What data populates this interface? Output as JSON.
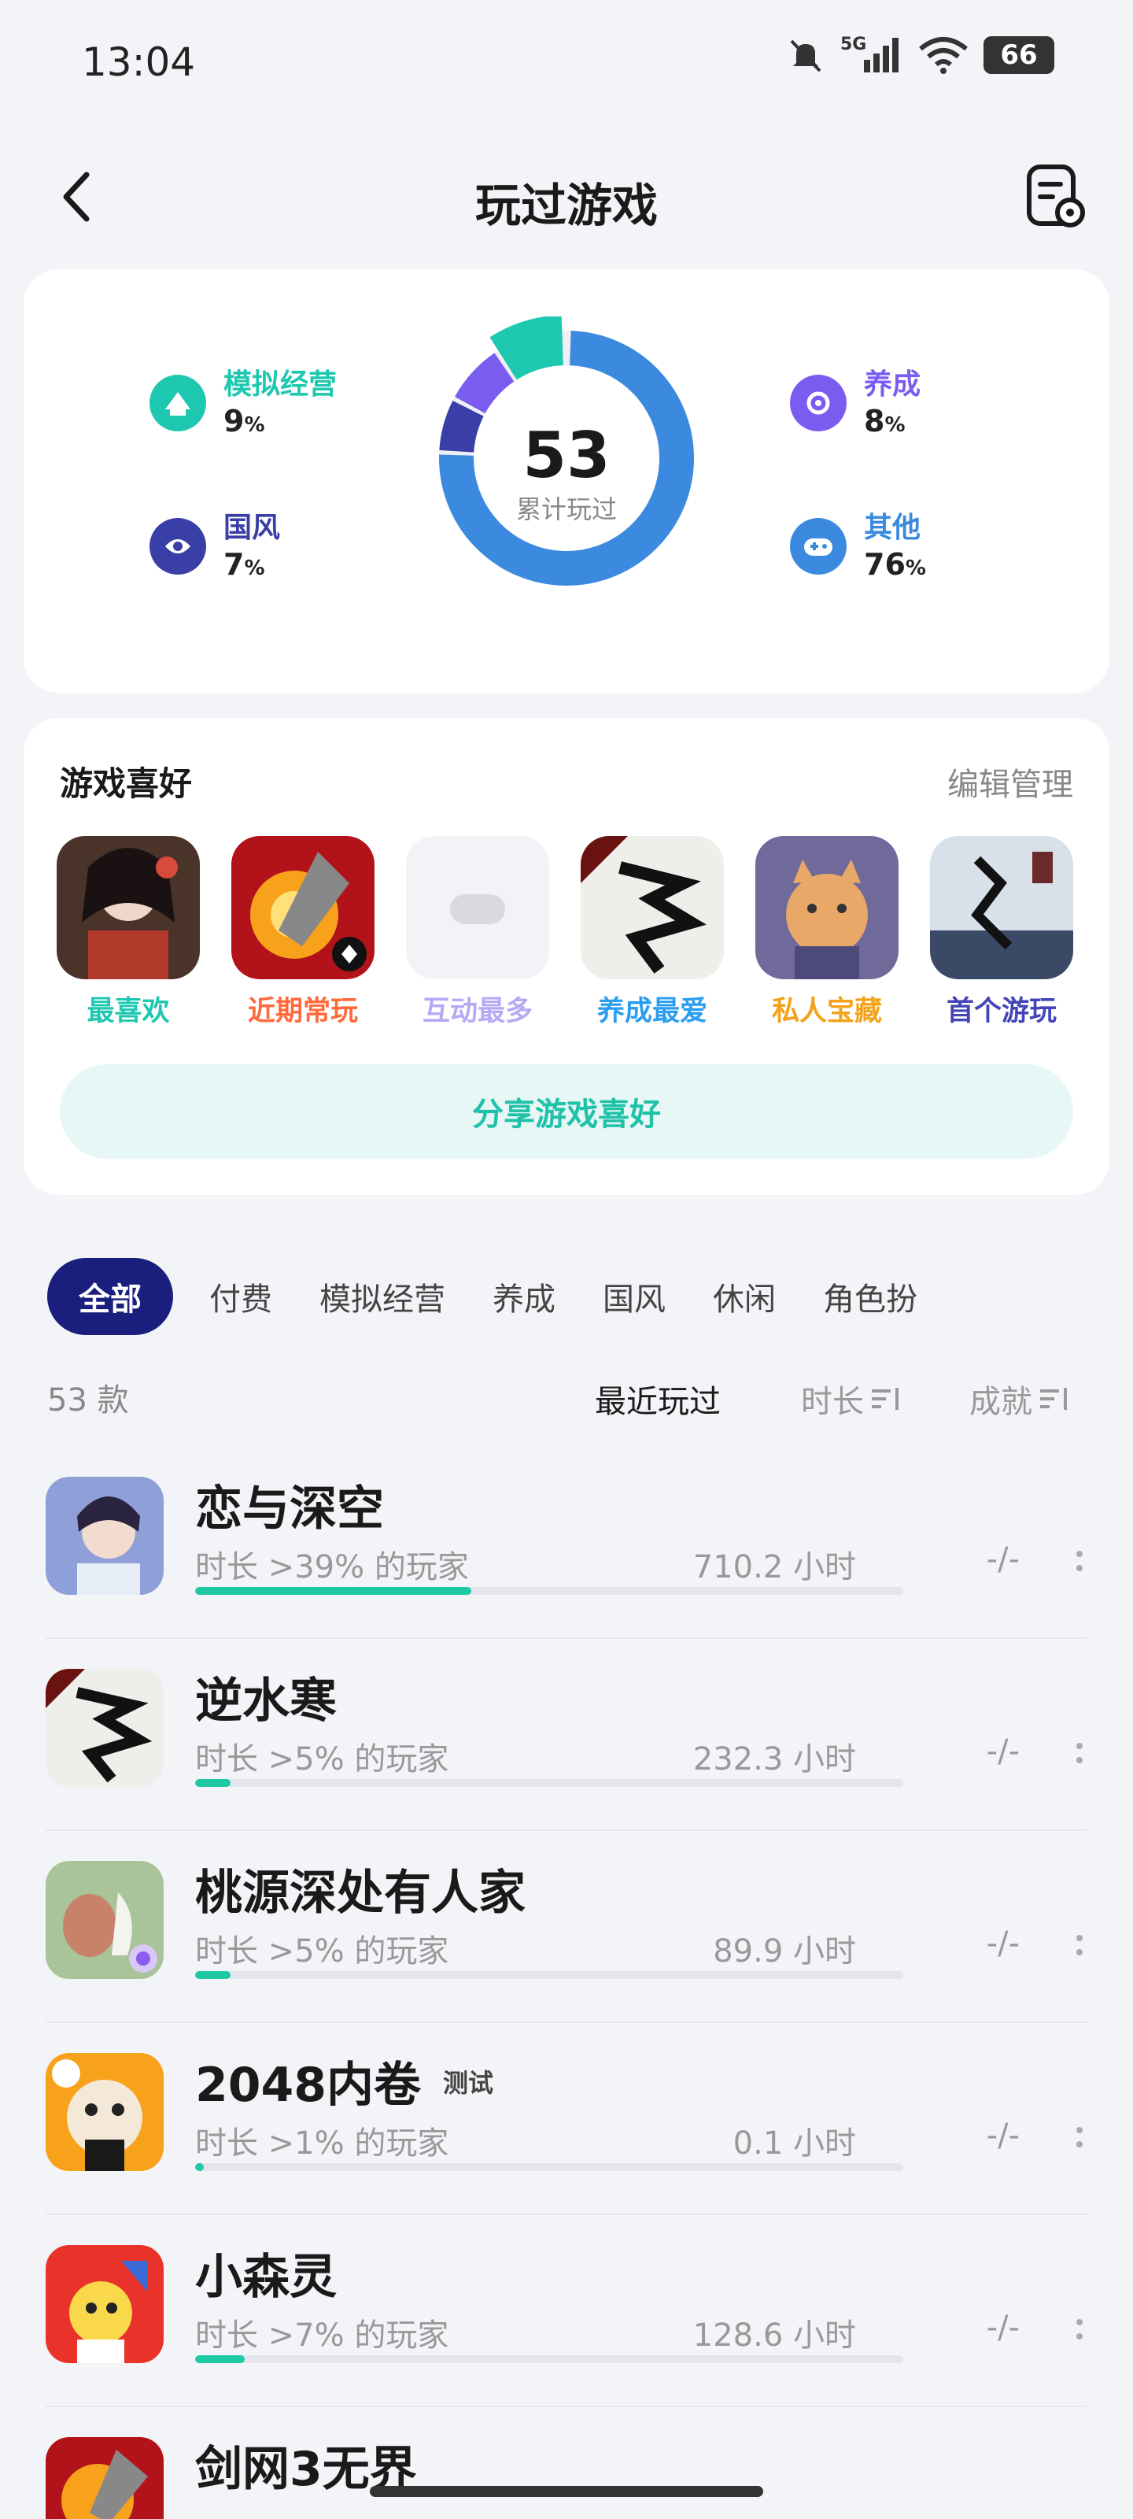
{
  "status_bar": {
    "time": "13:04",
    "network": "5G",
    "battery": "66"
  },
  "header": {
    "title": "玩过游戏"
  },
  "stats": {
    "total": "53",
    "total_label": "累计玩过",
    "categories": [
      {
        "name": "模拟经营",
        "pct": "9",
        "color": "#1ec8b0"
      },
      {
        "name": "国风",
        "pct": "7",
        "color": "#3a3fa8"
      },
      {
        "name": "养成",
        "pct": "8",
        "color": "#7a5cf0"
      },
      {
        "name": "其他",
        "pct": "76",
        "color": "#3b8ae0"
      }
    ],
    "percent_sign": "%"
  },
  "preferences": {
    "title": "游戏喜好",
    "edit_label": "编辑管理",
    "items": [
      {
        "label": "最喜欢",
        "color": "#1ec8b0"
      },
      {
        "label": "近期常玩",
        "color": "#ff6a3d"
      },
      {
        "label": "互动最多",
        "color": "#b7a8f5"
      },
      {
        "label": "养成最爱",
        "color": "#2a9ef0"
      },
      {
        "label": "私人宝藏",
        "color": "#f3a21a"
      },
      {
        "label": "首个游玩",
        "color": "#4446b8"
      }
    ],
    "share_label": "分享游戏喜好"
  },
  "tabs": [
    "全部",
    "付费",
    "模拟经营",
    "养成",
    "国风",
    "休闲",
    "角色扮"
  ],
  "list_meta": {
    "count": "53 款",
    "sort_recent": "最近玩过",
    "sort_duration": "时长",
    "sort_achievement": "成就"
  },
  "games": [
    {
      "name": "恋与深空",
      "tag": "",
      "sub": "时长 >39% 的玩家",
      "hours": "710.2 小时",
      "achievement": "-/-",
      "progress": 0.39
    },
    {
      "name": "逆水寒",
      "tag": "",
      "sub": "时长 >5% 的玩家",
      "hours": "232.3 小时",
      "achievement": "-/-",
      "progress": 0.05
    },
    {
      "name": "桃源深处有人家",
      "tag": "",
      "sub": "时长 >5% 的玩家",
      "hours": "89.9 小时",
      "achievement": "-/-",
      "progress": 0.05
    },
    {
      "name": "2048内卷",
      "tag": "测试",
      "sub": "时长 >1% 的玩家",
      "hours": "0.1 小时",
      "achievement": "-/-",
      "progress": 0.01
    },
    {
      "name": "小森灵",
      "tag": "",
      "sub": "时长 >7% 的玩家",
      "hours": "128.6 小时",
      "achievement": "-/-",
      "progress": 0.07
    },
    {
      "name": "剑网3无界",
      "tag": "",
      "sub": "",
      "hours": "",
      "achievement": "",
      "progress": 0.01
    }
  ]
}
